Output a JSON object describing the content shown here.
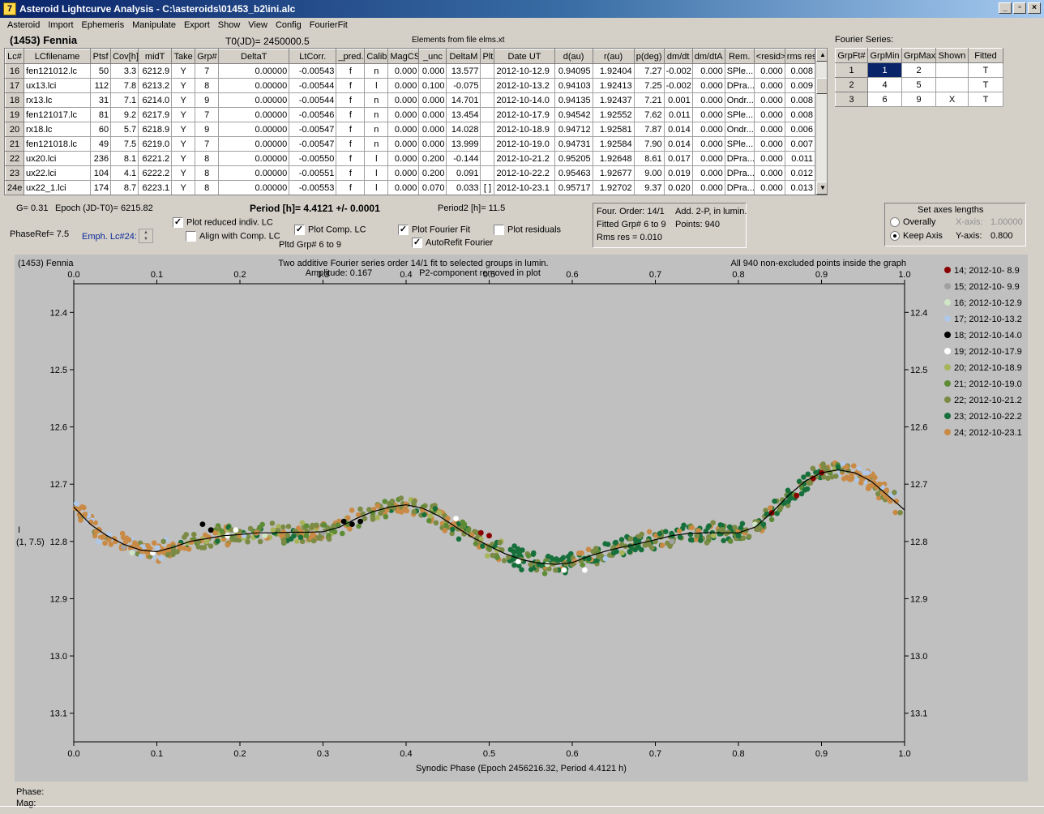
{
  "title": "Asteroid Lightcurve Analysis - C:\\asteroids\\01453_b2\\ini.alc",
  "menu": [
    "Asteroid",
    "Import",
    "Ephemeris",
    "Manipulate",
    "Export",
    "Show",
    "View",
    "Config",
    "FourierFit"
  ],
  "asteroid_name": "(1453) Fennia",
  "t0": "T0(JD)= 2450000.5",
  "elements": "Elements from file elms.xt",
  "table": {
    "headers": [
      "Lc#",
      "LCfilename",
      "Ptsf",
      "Cov[h]",
      "midT",
      "Take",
      "Grp#",
      "DeltaT",
      "LtCorr.",
      "_pred.",
      "Calib.",
      "MagCS",
      "_unc",
      "DeltaM",
      "Plt",
      "Date UT",
      "d(au)",
      "r(au)",
      "p(deg)",
      "dm/dt",
      "dm/dtA",
      "Rem.",
      "<resid>",
      "rms res"
    ],
    "rows": [
      [
        "16",
        "fen121012.lc",
        "50",
        "3.3",
        "6212.9",
        "Y",
        "7",
        "0.00000",
        "-0.00543",
        "f",
        "n",
        "0.000",
        "0.000",
        "13.577",
        "",
        "2012-10-12.9",
        "0.94095",
        "1.92404",
        "7.27",
        "-0.002",
        "0.000",
        "SPle...",
        "0.000",
        "0.008"
      ],
      [
        "17",
        "ux13.lci",
        "112",
        "7.8",
        "6213.2",
        "Y",
        "8",
        "0.00000",
        "-0.00544",
        "f",
        "l",
        "0.000",
        "0.100",
        "-0.075",
        "",
        "2012-10-13.2",
        "0.94103",
        "1.92413",
        "7.25",
        "-0.002",
        "0.000",
        "DPra...",
        "0.000",
        "0.009"
      ],
      [
        "18",
        "rx13.lc",
        "31",
        "7.1",
        "6214.0",
        "Y",
        "9",
        "0.00000",
        "-0.00544",
        "f",
        "n",
        "0.000",
        "0.000",
        "14.701",
        "",
        "2012-10-14.0",
        "0.94135",
        "1.92437",
        "7.21",
        "0.001",
        "0.000",
        "Ondr...",
        "0.000",
        "0.008"
      ],
      [
        "19",
        "fen121017.lc",
        "81",
        "9.2",
        "6217.9",
        "Y",
        "7",
        "0.00000",
        "-0.00546",
        "f",
        "n",
        "0.000",
        "0.000",
        "13.454",
        "",
        "2012-10-17.9",
        "0.94542",
        "1.92552",
        "7.62",
        "0.011",
        "0.000",
        "SPle...",
        "0.000",
        "0.008"
      ],
      [
        "20",
        "rx18.lc",
        "60",
        "5.7",
        "6218.9",
        "Y",
        "9",
        "0.00000",
        "-0.00547",
        "f",
        "n",
        "0.000",
        "0.000",
        "14.028",
        "",
        "2012-10-18.9",
        "0.94712",
        "1.92581",
        "7.87",
        "0.014",
        "0.000",
        "Ondr...",
        "0.000",
        "0.006"
      ],
      [
        "21",
        "fen121018.lc",
        "49",
        "7.5",
        "6219.0",
        "Y",
        "7",
        "0.00000",
        "-0.00547",
        "f",
        "n",
        "0.000",
        "0.000",
        "13.999",
        "",
        "2012-10-19.0",
        "0.94731",
        "1.92584",
        "7.90",
        "0.014",
        "0.000",
        "SPle...",
        "0.000",
        "0.007"
      ],
      [
        "22",
        "ux20.lci",
        "236",
        "8.1",
        "6221.2",
        "Y",
        "8",
        "0.00000",
        "-0.00550",
        "f",
        "l",
        "0.000",
        "0.200",
        "-0.144",
        "",
        "2012-10-21.2",
        "0.95205",
        "1.92648",
        "8.61",
        "0.017",
        "0.000",
        "DPra...",
        "0.000",
        "0.011"
      ],
      [
        "23",
        "ux22.lci",
        "104",
        "4.1",
        "6222.2",
        "Y",
        "8",
        "0.00000",
        "-0.00551",
        "f",
        "l",
        "0.000",
        "0.200",
        "0.091",
        "",
        "2012-10-22.2",
        "0.95463",
        "1.92677",
        "9.00",
        "0.019",
        "0.000",
        "DPra...",
        "0.000",
        "0.012"
      ],
      [
        "24e",
        "ux22_1.lci",
        "174",
        "8.7",
        "6223.1",
        "Y",
        "8",
        "0.00000",
        "-0.00553",
        "f",
        "l",
        "0.000",
        "0.070",
        "0.033",
        "[ ]",
        "2012-10-23.1",
        "0.95717",
        "1.92702",
        "9.37",
        "0.020",
        "0.000",
        "DPra...",
        "0.000",
        "0.013"
      ]
    ]
  },
  "fourier_table": {
    "label": "Fourier Series:",
    "headers": [
      "GrpFt#",
      "GrpMin",
      "GrpMax",
      "Shown",
      "Fitted"
    ],
    "rows": [
      [
        "1",
        "1",
        "2",
        "",
        "T"
      ],
      [
        "2",
        "4",
        "5",
        "",
        "T"
      ],
      [
        "3",
        "6",
        "9",
        "X",
        "T"
      ]
    ]
  },
  "params": {
    "g": "G= 0.31",
    "epoch": "Epoch (JD-T0)= 6215.82",
    "period": "Period [h]= 4.4121 +/- 0.0001",
    "period2": "Period2 [h]= 11.5",
    "phaseref": "PhaseRef= 7.5",
    "emph": "Emph. Lc#24:",
    "pltd": "Pltd Grp#  6  to  9"
  },
  "checkboxes": {
    "plot_reduced": {
      "label": "Plot reduced indiv. LC",
      "checked": "✓"
    },
    "align": {
      "label": "Align with Comp. LC",
      "checked": ""
    },
    "plot_comp": {
      "label": "Plot Comp. LC",
      "checked": "✓"
    },
    "plot_fourier": {
      "label": "Plot Fourier Fit",
      "checked": "✓"
    },
    "autorefit": {
      "label": "AutoRefit Fourier",
      "checked": "✓"
    },
    "plot_resid": {
      "label": "Plot residuals",
      "checked": ""
    }
  },
  "fourier_info": {
    "order": "Four. Order: 14/1",
    "add": "Add. 2-P, in lumin.",
    "fitted": "Fitted Grp# 6 to 9",
    "points": "Points: 940",
    "rms": "Rms res     = 0.010"
  },
  "axes_panel": {
    "title": "Set axes lengths",
    "overall": "Overally",
    "keep": "Keep Axis",
    "xaxis_label": "X-axis:",
    "xaxis_val": "1.00000",
    "yaxis_label": "Y-axis:",
    "yaxis_val": "0.800"
  },
  "plot": {
    "name": "(1453) Fennia",
    "subtitle1": "Two additive Fourier series order 14/1 fit to selected groups in lumin.",
    "subtitle2": "Amplitude: 0.167",
    "subtitle3": "P2-component removed in plot",
    "points_note": "All 940 non-excluded points inside the graph",
    "ylabel1": "I",
    "ylabel2": "(1, 7.5)",
    "xlabel": "Synodic Phase (Epoch 2456216.32, Period 4.4121 h)"
  },
  "chart_data": {
    "type": "scatter",
    "xlim": [
      0.0,
      1.0
    ],
    "ylim": [
      12.35,
      13.15
    ],
    "y_inverted": true,
    "xticks": [
      "0.0",
      "0.1",
      "0.2",
      "0.3",
      "0.4",
      "0.5",
      "0.6",
      "0.7",
      "0.8",
      "0.9",
      "1.0"
    ],
    "yticks": [
      "12.4",
      "12.5",
      "12.6",
      "12.7",
      "12.8",
      "12.9",
      "13.0",
      "13.1"
    ],
    "fit_curve": {
      "x": [
        0.0,
        0.02,
        0.04,
        0.06,
        0.08,
        0.1,
        0.12,
        0.14,
        0.16,
        0.18,
        0.2,
        0.22,
        0.24,
        0.26,
        0.28,
        0.3,
        0.32,
        0.34,
        0.36,
        0.38,
        0.4,
        0.42,
        0.44,
        0.46,
        0.48,
        0.5,
        0.52,
        0.54,
        0.56,
        0.58,
        0.6,
        0.62,
        0.64,
        0.66,
        0.68,
        0.7,
        0.72,
        0.74,
        0.76,
        0.78,
        0.8,
        0.82,
        0.84,
        0.86,
        0.88,
        0.9,
        0.92,
        0.94,
        0.96,
        0.98,
        1.0
      ],
      "y": [
        12.74,
        12.77,
        12.79,
        12.805,
        12.815,
        12.818,
        12.81,
        12.8,
        12.795,
        12.79,
        12.788,
        12.785,
        12.785,
        12.784,
        12.784,
        12.783,
        12.775,
        12.76,
        12.748,
        12.74,
        12.736,
        12.742,
        12.756,
        12.775,
        12.793,
        12.808,
        12.822,
        12.832,
        12.838,
        12.84,
        12.837,
        12.826,
        12.817,
        12.81,
        12.804,
        12.797,
        12.79,
        12.786,
        12.785,
        12.785,
        12.785,
        12.775,
        12.75,
        12.72,
        12.695,
        12.68,
        12.675,
        12.68,
        12.695,
        12.72,
        12.745
      ]
    },
    "legend": [
      {
        "label": "14; 2012-10- 8.9",
        "color": "#8b0000"
      },
      {
        "label": "15; 2012-10- 9.9",
        "color": "#a0a0a0"
      },
      {
        "label": "16; 2012-10-12.9",
        "color": "#cfe5c5"
      },
      {
        "label": "17; 2012-10-13.2",
        "color": "#b0c8e8"
      },
      {
        "label": "18; 2012-10-14.0",
        "color": "#000000"
      },
      {
        "label": "19; 2012-10-17.9",
        "color": "#ffffff"
      },
      {
        "label": "20; 2012-10-18.9",
        "color": "#a8b45a"
      },
      {
        "label": "21; 2012-10-19.0",
        "color": "#5e8c36"
      },
      {
        "label": "22; 2012-10-21.2",
        "color": "#7b8a45"
      },
      {
        "label": "23; 2012-10-22.2",
        "color": "#17703b"
      },
      {
        "label": "24; 2012-10-23.1",
        "color": "#c98a45"
      }
    ],
    "series_samples": {
      "name_note": "representative points per group (phase, mag)",
      "groups": [
        {
          "color": "#c98a45",
          "points": [
            [
              0.01,
              12.74
            ],
            [
              0.03,
              12.78
            ],
            [
              0.05,
              12.8
            ],
            [
              0.07,
              12.81
            ],
            [
              0.09,
              12.82
            ],
            [
              0.2,
              12.79
            ],
            [
              0.22,
              12.785
            ],
            [
              0.25,
              12.79
            ],
            [
              0.4,
              12.735
            ],
            [
              0.42,
              12.745
            ],
            [
              0.45,
              12.76
            ],
            [
              0.5,
              12.79
            ],
            [
              0.93,
              12.67
            ],
            [
              0.95,
              12.69
            ],
            [
              0.97,
              12.7
            ],
            [
              0.99,
              12.73
            ]
          ]
        },
        {
          "color": "#7b8a45",
          "points": [
            [
              0.12,
              12.81
            ],
            [
              0.15,
              12.8
            ],
            [
              0.18,
              12.79
            ],
            [
              0.35,
              12.76
            ],
            [
              0.38,
              12.74
            ],
            [
              0.41,
              12.73
            ],
            [
              0.55,
              12.84
            ],
            [
              0.58,
              12.85
            ],
            [
              0.6,
              12.84
            ],
            [
              0.7,
              12.8
            ],
            [
              0.75,
              12.79
            ],
            [
              0.78,
              12.78
            ],
            [
              0.85,
              12.74
            ]
          ]
        },
        {
          "color": "#17703b",
          "points": [
            [
              0.53,
              12.83
            ],
            [
              0.56,
              12.84
            ],
            [
              0.62,
              12.83
            ],
            [
              0.65,
              12.82
            ],
            [
              0.68,
              12.8
            ],
            [
              0.72,
              12.79
            ],
            [
              0.8,
              12.79
            ],
            [
              0.83,
              12.77
            ],
            [
              0.86,
              12.73
            ],
            [
              0.88,
              12.71
            ],
            [
              0.9,
              12.68
            ],
            [
              0.92,
              12.67
            ]
          ]
        },
        {
          "color": "#5e8c36",
          "points": [
            [
              0.28,
              12.79
            ],
            [
              0.31,
              12.78
            ],
            [
              0.33,
              12.77
            ],
            [
              0.36,
              12.75
            ],
            [
              0.47,
              12.77
            ],
            [
              0.5,
              12.81
            ]
          ]
        },
        {
          "color": "#a8b45a",
          "points": [
            [
              0.16,
              12.8
            ],
            [
              0.24,
              12.78
            ],
            [
              0.44,
              12.75
            ],
            [
              0.66,
              12.82
            ],
            [
              0.77,
              12.79
            ]
          ]
        },
        {
          "color": "#000000",
          "points": [
            [
              0.155,
              12.77
            ],
            [
              0.165,
              12.78
            ],
            [
              0.325,
              12.765
            ],
            [
              0.335,
              12.77
            ],
            [
              0.345,
              12.765
            ]
          ]
        },
        {
          "color": "#8b0000",
          "points": [
            [
              0.49,
              12.785
            ],
            [
              0.5,
              12.79
            ],
            [
              0.84,
              12.75
            ],
            [
              0.87,
              12.72
            ],
            [
              0.89,
              12.69
            ],
            [
              0.9,
              12.68
            ]
          ]
        },
        {
          "color": "#ffffff",
          "points": [
            [
              0.095,
              12.82
            ],
            [
              0.185,
              12.79
            ],
            [
              0.195,
              12.78
            ],
            [
              0.46,
              12.76
            ],
            [
              0.535,
              12.835
            ],
            [
              0.59,
              12.85
            ],
            [
              0.615,
              12.85
            ]
          ]
        },
        {
          "color": "#b0c8e8",
          "points": [
            [
              0.03,
              12.8
            ],
            [
              0.105,
              12.83
            ],
            [
              0.205,
              12.79
            ],
            [
              0.64,
              12.83
            ],
            [
              0.955,
              12.68
            ]
          ]
        },
        {
          "color": "#a0a0a0",
          "points": [
            [
              0.06,
              12.81
            ],
            [
              0.3,
              12.785
            ],
            [
              0.72,
              12.8
            ]
          ]
        },
        {
          "color": "#cfe5c5",
          "points": [
            [
              0.07,
              12.82
            ],
            [
              0.23,
              12.79
            ],
            [
              0.57,
              12.84
            ],
            [
              0.82,
              12.77
            ]
          ]
        }
      ]
    }
  },
  "status": {
    "phase": "Phase:",
    "mag": "Mag:"
  }
}
